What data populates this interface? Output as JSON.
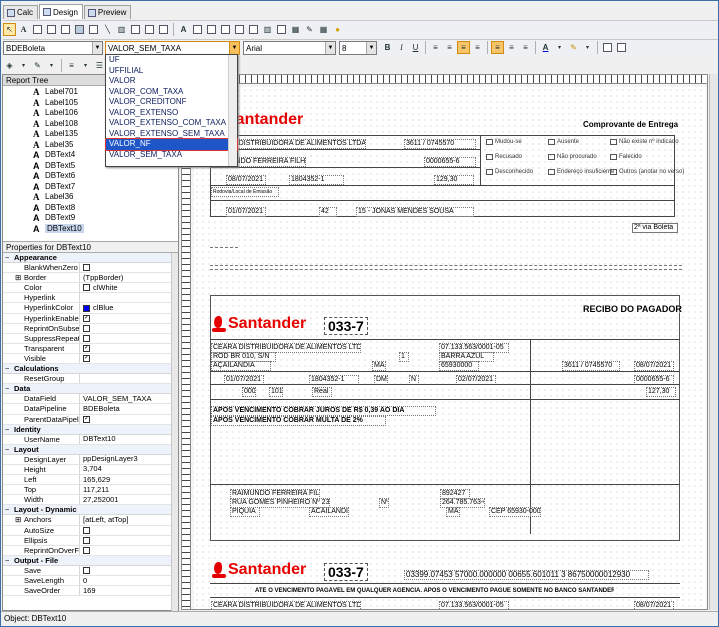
{
  "tabs": [
    {
      "label": "Calc"
    },
    {
      "label": "Design"
    },
    {
      "label": "Preview"
    }
  ],
  "toolbar2": {
    "datapipeline": "BDEBoleta",
    "datafield": "VALOR_SEM_TAXA",
    "font_name": "Arial",
    "font_size": "8"
  },
  "style_buttons": {
    "bold": "B",
    "italic": "I",
    "underline": "U"
  },
  "datafield_options": [
    "UF",
    "UFFILIAL",
    "VALOR",
    "VALOR_COM_TAXA",
    "VALOR_CREDITONF",
    "VALOR_EXTENSO",
    "VALOR_EXTENSO_COM_TAXA",
    "VALOR_EXTENSO_SEM_TAXA",
    "VALOR_NF",
    "VALOR_SEM_TAXA"
  ],
  "selected_option": "VALOR_NF",
  "report_tree": {
    "title": "Report Tree",
    "items": [
      "Label701",
      "Label105",
      "Label106",
      "Label108",
      "Label135",
      "Label35",
      "DBText4",
      "DBText5",
      "DBText6",
      "DBText7",
      "Label36",
      "DBText8",
      "DBText9",
      "DBText10"
    ],
    "selected": "DBText10"
  },
  "properties": {
    "title": "Properties for DBText10",
    "rows": [
      {
        "cat": "Appearance"
      },
      {
        "name": "BlankWhenZero",
        "check": false
      },
      {
        "name": "Border",
        "value": "(TppBorder)",
        "expand": true
      },
      {
        "name": "Color",
        "value": "clWhite",
        "swatch": "#ffffff"
      },
      {
        "name": "Hyperlink",
        "value": ""
      },
      {
        "name": "HyperlinkColor",
        "value": "clBlue",
        "swatch": "#0000ff"
      },
      {
        "name": "HyperlinkEnabled",
        "check": true
      },
      {
        "name": "ReprintOnSubsequ",
        "check": false
      },
      {
        "name": "SuppressRepeatec",
        "check": false
      },
      {
        "name": "Transparent",
        "check": true
      },
      {
        "name": "Visible",
        "check": true
      },
      {
        "cat": "Calculations"
      },
      {
        "name": "ResetGroup",
        "value": ""
      },
      {
        "cat": "Data"
      },
      {
        "name": "DataField",
        "value": "VALOR_SEM_TAXA"
      },
      {
        "name": "DataPipeline",
        "value": "BDEBoleta"
      },
      {
        "name": "ParentDataPipelin",
        "check": true
      },
      {
        "cat": "Identity"
      },
      {
        "name": "UserName",
        "value": "DBText10"
      },
      {
        "cat": "Layout"
      },
      {
        "name": "DesignLayer",
        "value": "ppDesignLayer3"
      },
      {
        "name": "Height",
        "value": "3,704"
      },
      {
        "name": "Left",
        "value": "165,629"
      },
      {
        "name": "Top",
        "value": "117,211"
      },
      {
        "name": "Width",
        "value": "27,252001"
      },
      {
        "cat": "Layout - Dynamic"
      },
      {
        "name": "Anchors",
        "value": "[atLeft, atTop]",
        "expand": true
      },
      {
        "name": "AutoSize",
        "check": false
      },
      {
        "name": "Ellipsis",
        "check": false
      },
      {
        "name": "ReprintOnOverFlo",
        "check": false
      },
      {
        "cat": "Output - File"
      },
      {
        "name": "Save",
        "check": false
      },
      {
        "name": "SaveLength",
        "value": "0"
      },
      {
        "name": "SaveOrder",
        "value": "169"
      }
    ]
  },
  "status": "Object: DBText10",
  "report": {
    "brand": "Santander",
    "bank_code": "033-7",
    "comprovante": "Comprovante de Entrega",
    "company": "CEARA DISTRIBUIDORA DE ALIMENTOS LTDA",
    "agency": "3611 / 0745570",
    "payer": "RAIMUNDO FERREIRA FILHO",
    "doc_number": "0000655-6",
    "date_venc": "08/07/2021",
    "nosso_numero": "1804352-1",
    "valor": "129,30",
    "data_doc": "01/07/2021",
    "dist_num": "42",
    "address_top": "15 - JONAS MENDES SOUSA",
    "motivos": [
      "Mudou-se",
      "Ausente",
      "Não existe nº indicado",
      "Recusado",
      "Não procurado",
      "Falecido",
      "Desconhecido",
      "Endereço insuficiente",
      "Outros (anotar no verso)"
    ],
    "via": "2ª via Boleta",
    "recibo": "RECIBO DO PAGADOR",
    "cnpj": "07.133.563/0001-05",
    "street": "ROD BR 010, S/N",
    "street_num": "1",
    "district": "BARRA AZUL",
    "city": "AÇAILANDIA",
    "uf": "MA",
    "cep": "65930000",
    "date_doc2": "01/07/2021",
    "especie": "DM",
    "aceite": "N",
    "data_proc": "02/07/2021",
    "carteira": "000",
    "carteira2": "101",
    "moeda": "Real",
    "nosso_num2": "127,30",
    "instr1": "APÓS VENCIMENTO COBRAR JUROS DE R$ 0,39  AO DIA",
    "instr2": "APÓS VENCIMENTO COBRAR MULTA DE 2%",
    "payer_addr": "RUA GOMES PINHEIRO Nº 231",
    "payer_no": "Nº",
    "payer_city": "PIQUIA",
    "payer_city2": "ACAILANDIA",
    "payer_uf": "MA",
    "payer_cep": "CEP  65930-000",
    "payer_id": "892427",
    "payer_cpf": "264.785.763-04",
    "linha_digitavel": "03399.07453  57000.000000  00655.601011  3  86750000012930",
    "local_pag": "ATÉ O VENCIMENTO PAGÁVEL EM QUALQUER AGÊNCIA. APÓS O VENCIMENTO PAGUE SOMENTE NO BANCO SANTANDER",
    "label_top": "Rodovia/Local de Emissão"
  }
}
